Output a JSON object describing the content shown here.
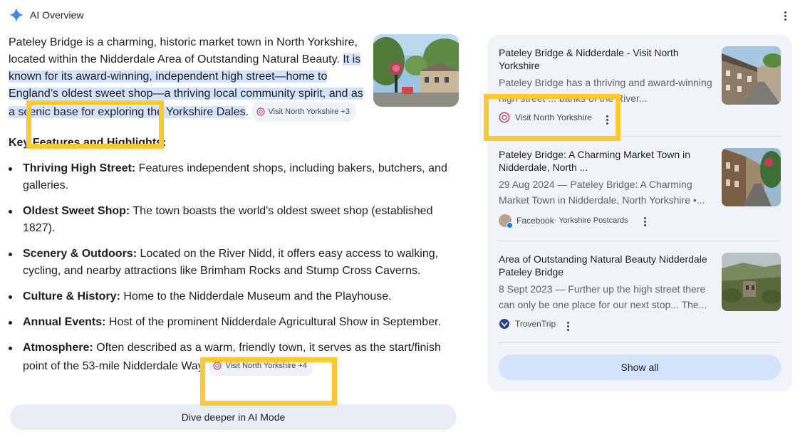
{
  "header": {
    "title": "AI Overview"
  },
  "intro": {
    "part1": "Pateley Bridge is a charming, historic market town in North Yorkshire, located within the Nidderdale Area of Outstanding Natural Beauty. ",
    "part2": "It is known for its award-winning, independent high street—home to England’s oldest sweet shop—a thriving local community spirit, and as a scenic base for exploring the Yorkshire Dales",
    "part3": ".",
    "chip": "Visit North Yorkshire +3"
  },
  "key_features_title": "Key Features and Highlights:",
  "features": [
    {
      "label": "Thriving High Street:",
      "text": " Features independent shops, including bakers, butchers, and galleries."
    },
    {
      "label": "Oldest Sweet Shop:",
      "text": " The town boasts the world's oldest sweet shop (established 1827)."
    },
    {
      "label": "Scenery & Outdoors:",
      "text": " Located on the River Nidd, it offers easy access to walking, cycling, and nearby attractions like Brimham Rocks and Stump Cross Caverns."
    },
    {
      "label": "Culture & History:",
      "text": " Home to the Nidderdale Museum and the Playhouse."
    },
    {
      "label": "Annual Events:",
      "text": " Host of the prominent Nidderdale Agricultural Show in September."
    },
    {
      "label": "Atmosphere:",
      "text": " Often described as a warm, friendly town, it serves as the start/finish point of the 53-mile Nidderdale Way.",
      "chip": "Visit North Yorkshire +4"
    }
  ],
  "dive_button": "Dive deeper in AI Mode",
  "sources": [
    {
      "title": "Pateley Bridge & Nidderdale - Visit North Yorkshire",
      "snippet": "Pateley Bridge has a thriving and award-winning high street ... banks of the River...",
      "source": "Visit North Yorkshire"
    },
    {
      "title": "Pateley Bridge: A Charming Market Town in Nidderdale, North ...",
      "snippet": "29 Aug 2024 — Pateley Bridge: A Charming Market Town in Nidderdale, North Yorkshire •...",
      "source": "Facebook",
      "source_sub": "· Yorkshire Postcards"
    },
    {
      "title": "Area of Outstanding Natural Beauty Nidderdale Pateley Bridge",
      "snippet": "8 Sept 2023 — Further up the high street there can only be one place for our next stop... The...",
      "source": "TrovenTrip"
    }
  ],
  "show_all": "Show all",
  "colors": {
    "highlight": "#d3e3fd",
    "panel": "#f0f4f9",
    "callout": "#fcc934",
    "gemini_blue": "#4285f4"
  }
}
